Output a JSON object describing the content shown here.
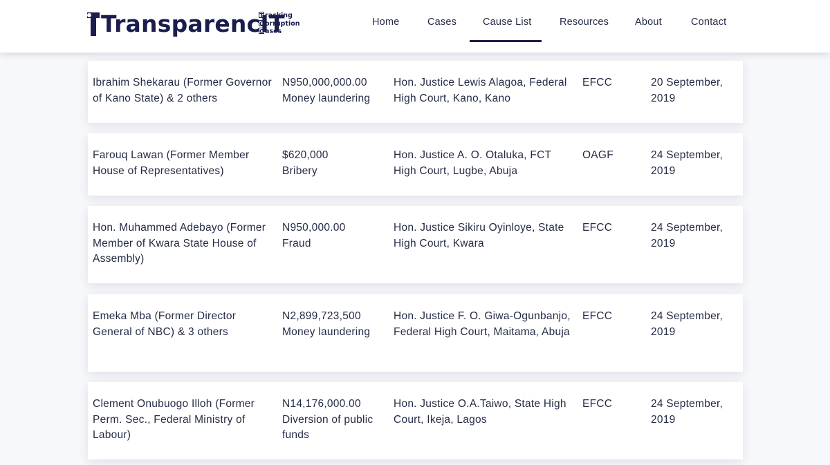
{
  "brand": {
    "name": "TransparencIT",
    "tagline": [
      "Tracking",
      "Corruption",
      "Cases"
    ],
    "tagline_initials": [
      "T",
      "C",
      "C"
    ],
    "tagline_rest": [
      "racking",
      "orruption",
      "ases"
    ],
    "color": "#1b1d4d"
  },
  "nav": {
    "items": [
      {
        "label": "Home"
      },
      {
        "label": "Cases"
      },
      {
        "label": "Cause List"
      },
      {
        "label": "Resources"
      },
      {
        "label": "About"
      },
      {
        "label": "Contact"
      }
    ],
    "active": "Cause List"
  },
  "cases": [
    {
      "defendant": "Ibrahim Shekarau (Former Governor of Kano State) & 2 others",
      "amount": "N950,000,000.00",
      "charge": "Money laundering",
      "court": "Hon. Justice Lewis Alagoa, Federal High Court, Kano, Kano",
      "agency": "EFCC",
      "date": "20 September, 2019"
    },
    {
      "defendant": "Farouq Lawan (Former Member House of Representatives)",
      "amount": "$620,000",
      "charge": "Bribery",
      "court": "Hon. Justice A. O. Otaluka, FCT High Court, Lugbe, Abuja",
      "agency": "OAGF",
      "date": "24 September, 2019"
    },
    {
      "defendant": "Hon. Muhammed Adebayo (Former Member of Kwara State House of Assembly)",
      "amount": "N950,000.00",
      "charge": "Fraud",
      "court": "Hon. Justice Sikiru Oyinloye, State High Court, Kwara",
      "agency": "EFCC",
      "date": "24 September, 2019"
    },
    {
      "defendant": "Emeka Mba (Former Director General of NBC) & 3 others",
      "amount": "N2,899,723,500",
      "charge": "Money laundering",
      "court": "Hon. Justice F. O. Giwa-Ogunbanjo, Federal High Court, Maitama, Abuja",
      "agency": "EFCC",
      "date": "24 September, 2019"
    },
    {
      "defendant": "Clement Onubuogo Illoh (Former Perm. Sec., Federal Ministry of Labour)",
      "amount": "N14,176,000.00",
      "charge": "Diversion of public funds",
      "court": "Hon. Justice O.A.Taiwo, State High Court, Ikeja, Lagos",
      "agency": "EFCC",
      "date": "24 September, 2019"
    }
  ]
}
